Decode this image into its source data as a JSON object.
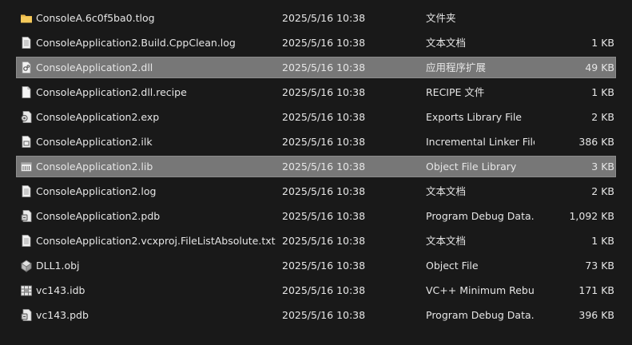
{
  "files": [
    {
      "name": "ConsoleA.6c0f5ba0.tlog",
      "date": "2025/5/16 10:38",
      "type": "文件夹",
      "size": "",
      "icon": "folder-icon",
      "selected": false
    },
    {
      "name": "ConsoleApplication2.Build.CppClean.log",
      "date": "2025/5/16 10:38",
      "type": "文本文档",
      "size": "1 KB",
      "icon": "text-document-icon",
      "selected": false
    },
    {
      "name": "ConsoleApplication2.dll",
      "date": "2025/5/16 10:38",
      "type": "应用程序扩展",
      "size": "49 KB",
      "icon": "dll-file-icon",
      "selected": true
    },
    {
      "name": "ConsoleApplication2.dll.recipe",
      "date": "2025/5/16 10:38",
      "type": "RECIPE 文件",
      "size": "1 KB",
      "icon": "blank-file-icon",
      "selected": false
    },
    {
      "name": "ConsoleApplication2.exp",
      "date": "2025/5/16 10:38",
      "type": "Exports Library File",
      "size": "2 KB",
      "icon": "exports-library-icon",
      "selected": false
    },
    {
      "name": "ConsoleApplication2.ilk",
      "date": "2025/5/16 10:38",
      "type": "Incremental Linker File",
      "size": "386 KB",
      "icon": "linker-file-icon",
      "selected": false
    },
    {
      "name": "ConsoleApplication2.lib",
      "date": "2025/5/16 10:38",
      "type": "Object File Library",
      "size": "3 KB",
      "icon": "library-file-icon",
      "selected": true
    },
    {
      "name": "ConsoleApplication2.log",
      "date": "2025/5/16 10:38",
      "type": "文本文档",
      "size": "2 KB",
      "icon": "text-document-icon",
      "selected": false
    },
    {
      "name": "ConsoleApplication2.pdb",
      "date": "2025/5/16 10:38",
      "type": "Program Debug Data...",
      "size": "1,092 KB",
      "icon": "debug-data-icon",
      "selected": false
    },
    {
      "name": "ConsoleApplication2.vcxproj.FileListAbsolute.txt",
      "date": "2025/5/16 10:38",
      "type": "文本文档",
      "size": "1 KB",
      "icon": "text-document-icon",
      "selected": false
    },
    {
      "name": "DLL1.obj",
      "date": "2025/5/16 10:38",
      "type": "Object File",
      "size": "73 KB",
      "icon": "object-file-icon",
      "selected": false
    },
    {
      "name": "vc143.idb",
      "date": "2025/5/16 10:38",
      "type": "VC++ Minimum Rebu...",
      "size": "171 KB",
      "icon": "rebuild-file-icon",
      "selected": false
    },
    {
      "name": "vc143.pdb",
      "date": "2025/5/16 10:38",
      "type": "Program Debug Data...",
      "size": "396 KB",
      "icon": "debug-data-icon",
      "selected": false
    }
  ]
}
